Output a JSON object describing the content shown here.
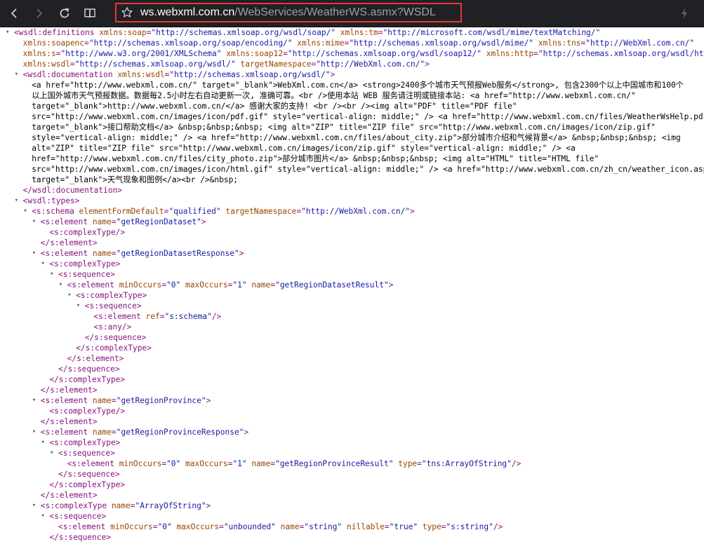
{
  "browser": {
    "url_host": "ws.webxml.com.cn",
    "url_path": "/WebServices/WeatherWS.asmx?WSDL"
  },
  "xml_lines": [
    {
      "d": 0,
      "t": "open",
      "p": [
        [
          "t",
          "<wsdl:definitions "
        ],
        [
          "n",
          "xmlns:soap"
        ],
        [
          "t",
          "="
        ],
        [
          "v",
          "\"http://schemas.xmlsoap.org/wsdl/soap/\""
        ],
        [
          "t",
          " "
        ],
        [
          "n",
          "xmlns:tm"
        ],
        [
          "t",
          "="
        ],
        [
          "v",
          "\"http://microsoft.com/wsdl/mime/textMatching/\""
        ]
      ]
    },
    {
      "d": 1,
      "t": "none",
      "p": [
        [
          "n",
          "xmlns:soapenc"
        ],
        [
          "t",
          "="
        ],
        [
          "v",
          "\"http://schemas.xmlsoap.org/soap/encoding/\""
        ],
        [
          "t",
          " "
        ],
        [
          "n",
          "xmlns:mime"
        ],
        [
          "t",
          "="
        ],
        [
          "v",
          "\"http://schemas.xmlsoap.org/wsdl/mime/\""
        ],
        [
          "t",
          " "
        ],
        [
          "n",
          "xmlns:tns"
        ],
        [
          "t",
          "="
        ],
        [
          "v",
          "\"http://WebXml.com.cn/\""
        ]
      ]
    },
    {
      "d": 1,
      "t": "none",
      "p": [
        [
          "n",
          "xmlns:s"
        ],
        [
          "t",
          "="
        ],
        [
          "v",
          "\"http://www.w3.org/2001/XMLSchema\""
        ],
        [
          "t",
          " "
        ],
        [
          "n",
          "xmlns:soap12"
        ],
        [
          "t",
          "="
        ],
        [
          "v",
          "\"http://schemas.xmlsoap.org/wsdl/soap12/\""
        ],
        [
          "t",
          " "
        ],
        [
          "n",
          "xmlns:http"
        ],
        [
          "t",
          "="
        ],
        [
          "v",
          "\"http://schemas.xmlsoap.org/wsdl/http/\""
        ]
      ]
    },
    {
      "d": 1,
      "t": "none",
      "p": [
        [
          "n",
          "xmlns:wsdl"
        ],
        [
          "t",
          "="
        ],
        [
          "v",
          "\"http://schemas.xmlsoap.org/wsdl/\""
        ],
        [
          "t",
          " "
        ],
        [
          "n",
          "targetNamespace"
        ],
        [
          "t",
          "="
        ],
        [
          "v",
          "\"http://WebXml.com.cn/\""
        ],
        [
          "t",
          ">"
        ]
      ]
    },
    {
      "d": 1,
      "t": "open",
      "p": [
        [
          "t",
          "<wsdl:documentation "
        ],
        [
          "n",
          "xmlns:wsdl"
        ],
        [
          "t",
          "="
        ],
        [
          "v",
          "\"http://schemas.xmlsoap.org/wsdl/\""
        ],
        [
          "t",
          ">"
        ]
      ]
    },
    {
      "d": 2,
      "t": "none",
      "p": [
        [
          "x",
          "<a href=\"http://www.webxml.com.cn/\" target=\"_blank\">WebXml.com.cn</a> <strong>2400多个城市天气预报Web服务</strong>, 包含2300个以上中国城市和100个"
        ]
      ]
    },
    {
      "d": 2,
      "t": "none",
      "p": [
        [
          "x",
          "以上国外城市天气预报数据。数据每2.5小时左右自动更新一次, 准确可靠。<br />使用本站 WEB 服务请注明或链接本站: <a href=\"http://www.webxml.com.cn/\""
        ]
      ]
    },
    {
      "d": 2,
      "t": "none",
      "p": [
        [
          "x",
          "target=\"_blank\">http://www.webxml.com.cn/</a> 感谢大家的支持! <br /><br /><img alt=\"PDF\" title=\"PDF file\""
        ]
      ]
    },
    {
      "d": 2,
      "t": "none",
      "p": [
        [
          "x",
          "src=\"http://www.webxml.com.cn/images/icon/pdf.gif\" style=\"vertical-align: middle;\" /> <a href=\"http://www.webxml.com.cn/files/WeatherWsHelp.pdf\""
        ]
      ]
    },
    {
      "d": 2,
      "t": "none",
      "p": [
        [
          "x",
          "target=\"_blank\">接口帮助文档</a> &nbsp;&nbsp;&nbsp; <img alt=\"ZIP\" title=\"ZIP file\" src=\"http://www.webxml.com.cn/images/icon/zip.gif\""
        ]
      ]
    },
    {
      "d": 2,
      "t": "none",
      "p": [
        [
          "x",
          "style=\"vertical-align: middle;\" /> <a href=\"http://www.webxml.com.cn/files/about_city.zip\">部分城市介绍和气候背景</a> &nbsp;&nbsp;&nbsp; <img"
        ]
      ]
    },
    {
      "d": 2,
      "t": "none",
      "p": [
        [
          "x",
          "alt=\"ZIP\" title=\"ZIP file\" src=\"http://www.webxml.com.cn/images/icon/zip.gif\" style=\"vertical-align: middle;\" /> <a"
        ]
      ]
    },
    {
      "d": 2,
      "t": "none",
      "p": [
        [
          "x",
          "href=\"http://www.webxml.com.cn/files/city_photo.zip\">部分城市图片</a> &nbsp;&nbsp;&nbsp; <img alt=\"HTML\" title=\"HTML file\""
        ]
      ]
    },
    {
      "d": 2,
      "t": "none",
      "p": [
        [
          "x",
          "src=\"http://www.webxml.com.cn/images/icon/html.gif\" style=\"vertical-align: middle;\" /> <a href=\"http://www.webxml.com.cn/zh_cn/weather_icon.aspx\""
        ]
      ]
    },
    {
      "d": 2,
      "t": "none",
      "p": [
        [
          "x",
          "target=\"_blank\">天气现象和图例</a><br />&nbsp;"
        ]
      ]
    },
    {
      "d": 1,
      "t": "none",
      "p": [
        [
          "t",
          "</wsdl:documentation>"
        ]
      ]
    },
    {
      "d": 1,
      "t": "open",
      "p": [
        [
          "t",
          "<wsdl:types>"
        ]
      ]
    },
    {
      "d": 2,
      "t": "open",
      "p": [
        [
          "t",
          "<s:schema "
        ],
        [
          "n",
          "elementFormDefault"
        ],
        [
          "t",
          "="
        ],
        [
          "v",
          "\"qualified\""
        ],
        [
          "t",
          " "
        ],
        [
          "n",
          "targetNamespace"
        ],
        [
          "t",
          "="
        ],
        [
          "v",
          "\"http://WebXml.com.cn/\""
        ],
        [
          "t",
          ">"
        ]
      ]
    },
    {
      "d": 3,
      "t": "open",
      "p": [
        [
          "t",
          "<s:element "
        ],
        [
          "n",
          "name"
        ],
        [
          "t",
          "="
        ],
        [
          "v",
          "\"getRegionDataset\""
        ],
        [
          "t",
          ">"
        ]
      ]
    },
    {
      "d": 4,
      "t": "none",
      "p": [
        [
          "t",
          "<s:complexType/>"
        ]
      ]
    },
    {
      "d": 3,
      "t": "none",
      "p": [
        [
          "t",
          "</s:element>"
        ]
      ]
    },
    {
      "d": 3,
      "t": "open",
      "p": [
        [
          "t",
          "<s:element "
        ],
        [
          "n",
          "name"
        ],
        [
          "t",
          "="
        ],
        [
          "v",
          "\"getRegionDatasetResponse\""
        ],
        [
          "t",
          ">"
        ]
      ]
    },
    {
      "d": 4,
      "t": "open",
      "p": [
        [
          "t",
          "<s:complexType>"
        ]
      ]
    },
    {
      "d": 5,
      "t": "open",
      "p": [
        [
          "t",
          "<s:sequence>"
        ]
      ]
    },
    {
      "d": 6,
      "t": "open",
      "p": [
        [
          "t",
          "<s:element "
        ],
        [
          "n",
          "minOccurs"
        ],
        [
          "t",
          "="
        ],
        [
          "v",
          "\"0\""
        ],
        [
          "t",
          " "
        ],
        [
          "n",
          "maxOccurs"
        ],
        [
          "t",
          "="
        ],
        [
          "v",
          "\"1\""
        ],
        [
          "t",
          " "
        ],
        [
          "n",
          "name"
        ],
        [
          "t",
          "="
        ],
        [
          "v",
          "\"getRegionDatasetResult\""
        ],
        [
          "t",
          ">"
        ]
      ]
    },
    {
      "d": 7,
      "t": "open",
      "p": [
        [
          "t",
          "<s:complexType>"
        ]
      ]
    },
    {
      "d": 8,
      "t": "open",
      "p": [
        [
          "t",
          "<s:sequence>"
        ]
      ]
    },
    {
      "d": 9,
      "t": "none",
      "p": [
        [
          "t",
          "<s:element "
        ],
        [
          "n",
          "ref"
        ],
        [
          "t",
          "="
        ],
        [
          "v",
          "\"s:schema\""
        ],
        [
          "t",
          "/>"
        ]
      ]
    },
    {
      "d": 9,
      "t": "none",
      "p": [
        [
          "t",
          "<s:any/>"
        ]
      ]
    },
    {
      "d": 8,
      "t": "none",
      "p": [
        [
          "t",
          "</s:sequence>"
        ]
      ]
    },
    {
      "d": 7,
      "t": "none",
      "p": [
        [
          "t",
          "</s:complexType>"
        ]
      ]
    },
    {
      "d": 6,
      "t": "none",
      "p": [
        [
          "t",
          "</s:element>"
        ]
      ]
    },
    {
      "d": 5,
      "t": "none",
      "p": [
        [
          "t",
          "</s:sequence>"
        ]
      ]
    },
    {
      "d": 4,
      "t": "none",
      "p": [
        [
          "t",
          "</s:complexType>"
        ]
      ]
    },
    {
      "d": 3,
      "t": "none",
      "p": [
        [
          "t",
          "</s:element>"
        ]
      ]
    },
    {
      "d": 3,
      "t": "open",
      "p": [
        [
          "t",
          "<s:element "
        ],
        [
          "n",
          "name"
        ],
        [
          "t",
          "="
        ],
        [
          "v",
          "\"getRegionProvince\""
        ],
        [
          "t",
          ">"
        ]
      ]
    },
    {
      "d": 4,
      "t": "none",
      "p": [
        [
          "t",
          "<s:complexType/>"
        ]
      ]
    },
    {
      "d": 3,
      "t": "none",
      "p": [
        [
          "t",
          "</s:element>"
        ]
      ]
    },
    {
      "d": 3,
      "t": "open",
      "p": [
        [
          "t",
          "<s:element "
        ],
        [
          "n",
          "name"
        ],
        [
          "t",
          "="
        ],
        [
          "v",
          "\"getRegionProvinceResponse\""
        ],
        [
          "t",
          ">"
        ]
      ]
    },
    {
      "d": 4,
      "t": "open",
      "p": [
        [
          "t",
          "<s:complexType>"
        ]
      ]
    },
    {
      "d": 5,
      "t": "open",
      "p": [
        [
          "t",
          "<s:sequence>"
        ]
      ]
    },
    {
      "d": 6,
      "t": "none",
      "p": [
        [
          "t",
          "<s:element "
        ],
        [
          "n",
          "minOccurs"
        ],
        [
          "t",
          "="
        ],
        [
          "v",
          "\"0\""
        ],
        [
          "t",
          " "
        ],
        [
          "n",
          "maxOccurs"
        ],
        [
          "t",
          "="
        ],
        [
          "v",
          "\"1\""
        ],
        [
          "t",
          " "
        ],
        [
          "n",
          "name"
        ],
        [
          "t",
          "="
        ],
        [
          "v",
          "\"getRegionProvinceResult\""
        ],
        [
          "t",
          " "
        ],
        [
          "n",
          "type"
        ],
        [
          "t",
          "="
        ],
        [
          "v",
          "\"tns:ArrayOfString\""
        ],
        [
          "t",
          "/>"
        ]
      ]
    },
    {
      "d": 5,
      "t": "none",
      "p": [
        [
          "t",
          "</s:sequence>"
        ]
      ]
    },
    {
      "d": 4,
      "t": "none",
      "p": [
        [
          "t",
          "</s:complexType>"
        ]
      ]
    },
    {
      "d": 3,
      "t": "none",
      "p": [
        [
          "t",
          "</s:element>"
        ]
      ]
    },
    {
      "d": 3,
      "t": "open",
      "p": [
        [
          "t",
          "<s:complexType "
        ],
        [
          "n",
          "name"
        ],
        [
          "t",
          "="
        ],
        [
          "v",
          "\"ArrayOfString\""
        ],
        [
          "t",
          ">"
        ]
      ]
    },
    {
      "d": 4,
      "t": "open",
      "p": [
        [
          "t",
          "<s:sequence>"
        ]
      ]
    },
    {
      "d": 5,
      "t": "none",
      "p": [
        [
          "t",
          "<s:element "
        ],
        [
          "n",
          "minOccurs"
        ],
        [
          "t",
          "="
        ],
        [
          "v",
          "\"0\""
        ],
        [
          "t",
          " "
        ],
        [
          "n",
          "maxOccurs"
        ],
        [
          "t",
          "="
        ],
        [
          "v",
          "\"unbounded\""
        ],
        [
          "t",
          " "
        ],
        [
          "n",
          "name"
        ],
        [
          "t",
          "="
        ],
        [
          "v",
          "\"string\""
        ],
        [
          "t",
          " "
        ],
        [
          "n",
          "nillable"
        ],
        [
          "t",
          "="
        ],
        [
          "v",
          "\"true\""
        ],
        [
          "t",
          " "
        ],
        [
          "n",
          "type"
        ],
        [
          "t",
          "="
        ],
        [
          "v",
          "\"s:string\""
        ],
        [
          "t",
          "/>"
        ]
      ]
    },
    {
      "d": 4,
      "t": "none",
      "p": [
        [
          "t",
          "</s:sequence>"
        ]
      ]
    }
  ]
}
